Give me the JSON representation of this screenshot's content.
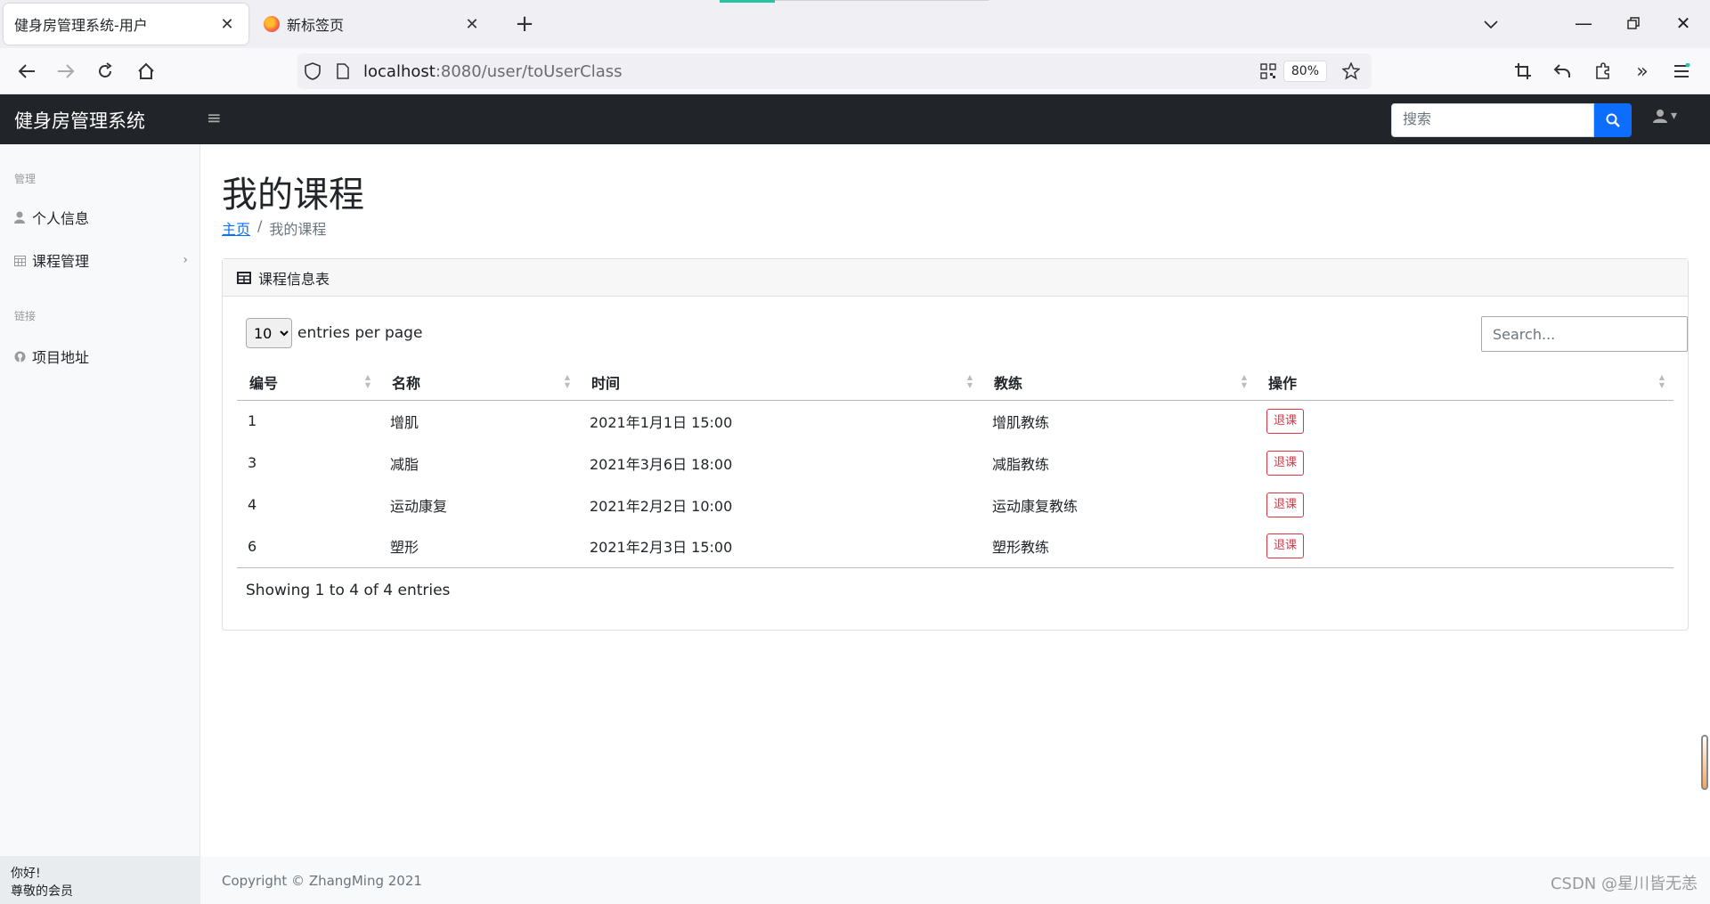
{
  "browser": {
    "active_tab_title": "健身房管理系统-用户",
    "inactive_tab_title": "新标签页",
    "url_host": "localhost",
    "url_rest": ":8080/user/toUserClass",
    "zoom": "80%"
  },
  "app": {
    "brand": "健身房管理系统",
    "search_placeholder": "搜索"
  },
  "sidebar": {
    "heading_manage": "管理",
    "heading_links": "链接",
    "items": [
      {
        "label": "个人信息",
        "icon": "user-icon"
      },
      {
        "label": "课程管理",
        "icon": "calendar-icon"
      },
      {
        "label": "项目地址",
        "icon": "github-icon"
      }
    ],
    "footer_line1": "你好!",
    "footer_line2": "尊敬的会员"
  },
  "page": {
    "title": "我的课程",
    "breadcrumb_home": "主页",
    "breadcrumb_current": "我的课程"
  },
  "card": {
    "header": "课程信息表",
    "entries_select": "10",
    "entries_label": "entries per page",
    "search_placeholder": "Search...",
    "columns": [
      "编号",
      "名称",
      "时间",
      "教练",
      "操作"
    ],
    "rows": [
      {
        "id": "1",
        "name": "增肌",
        "time": "2021年1月1日 15:00",
        "coach": "增肌教练",
        "action": "退课"
      },
      {
        "id": "3",
        "name": "减脂",
        "time": "2021年3月6日 18:00",
        "coach": "减脂教练",
        "action": "退课"
      },
      {
        "id": "4",
        "name": "运动康复",
        "time": "2021年2月2日 10:00",
        "coach": "运动康复教练",
        "action": "退课"
      },
      {
        "id": "6",
        "name": "塑形",
        "time": "2021年2月3日 15:00",
        "coach": "塑形教练",
        "action": "退课"
      }
    ],
    "info": "Showing 1 to 4 of 4 entries"
  },
  "footer": {
    "copyright": "Copyright © ZhangMing 2021",
    "watermark": "CSDN @星川皆无恙"
  },
  "colors": {
    "nav_dark": "#212529",
    "primary": "#0d6efd",
    "danger": "#dc3545"
  }
}
